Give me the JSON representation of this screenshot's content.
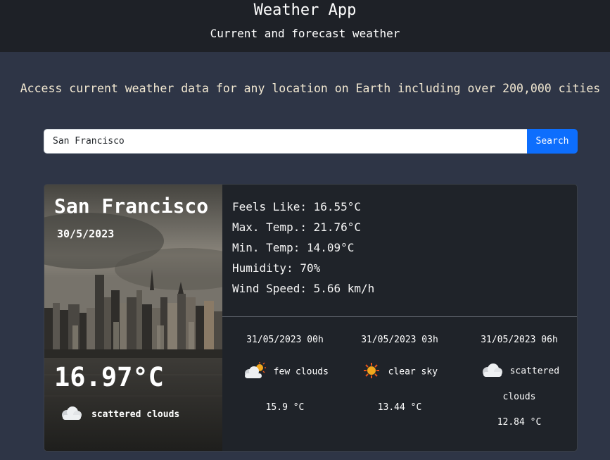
{
  "header": {
    "title": "Weather App",
    "subtitle": "Current and forecast weather"
  },
  "tagline": "Access current weather data for any location on Earth including over 200,000 cities",
  "search": {
    "value": "San Francisco",
    "button_label": "Search"
  },
  "current": {
    "city": "San Francisco",
    "date": "30/5/2023",
    "temperature": "16.97°C",
    "icon": "scattered-clouds-icon",
    "description": "scattered clouds"
  },
  "details": [
    "Feels Like: 16.55°C",
    "Max. Temp.: 21.76°C",
    "Min. Temp: 14.09°C",
    "Humidity: 70%",
    "Wind Speed: 5.66 km/h"
  ],
  "forecast": [
    {
      "time": "31/05/2023 00h",
      "icon": "few-clouds-icon",
      "description": "few clouds",
      "temp": "15.9 °C"
    },
    {
      "time": "31/05/2023 03h",
      "icon": "clear-sky-icon",
      "description": "clear sky",
      "temp": "13.44 °C"
    },
    {
      "time": "31/05/2023 06h",
      "icon": "scattered-clouds-icon",
      "description": "scattered clouds",
      "desc_line1": "scattered",
      "desc_line2": "clouds",
      "temp": "12.84 °C"
    }
  ],
  "colors": {
    "page_bg": "#2e3546",
    "header_bg": "#1e2127",
    "card_bg": "#1f2329",
    "accent": "#0d6efd",
    "tagline": "#f3e9d2"
  }
}
